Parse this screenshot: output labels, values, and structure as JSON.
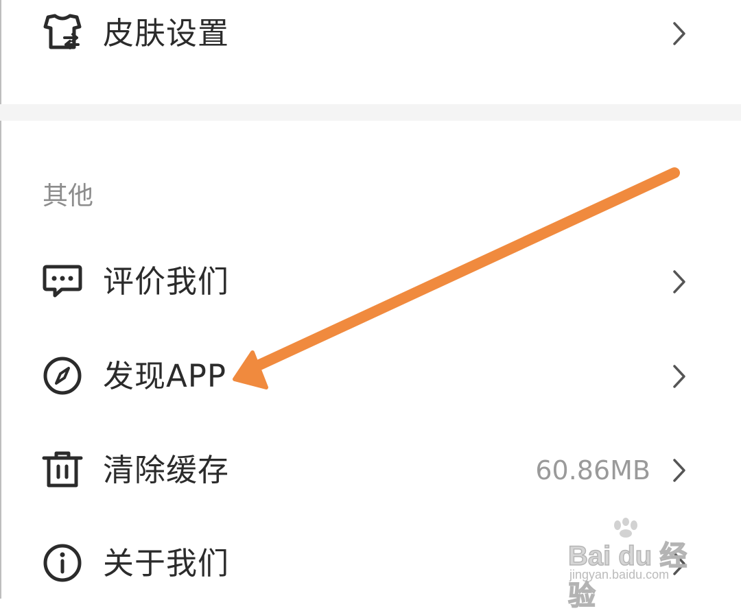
{
  "skin_settings": {
    "label": "皮肤设置",
    "icon": "tshirt-icon"
  },
  "section": {
    "title": "其他"
  },
  "items": [
    {
      "label": "评价我们",
      "icon": "message-icon",
      "value": ""
    },
    {
      "label": "发现APP",
      "icon": "compass-icon",
      "value": ""
    },
    {
      "label": "清除缓存",
      "icon": "trash-icon",
      "value": "60.86MB"
    },
    {
      "label": "关于我们",
      "icon": "info-icon",
      "value": ""
    }
  ],
  "annotation": {
    "type": "arrow",
    "color": "#F08A3E",
    "points_to": "发现APP"
  },
  "watermark": {
    "brand": "Bai du 经验",
    "url": "jingyan.baidu.com"
  }
}
